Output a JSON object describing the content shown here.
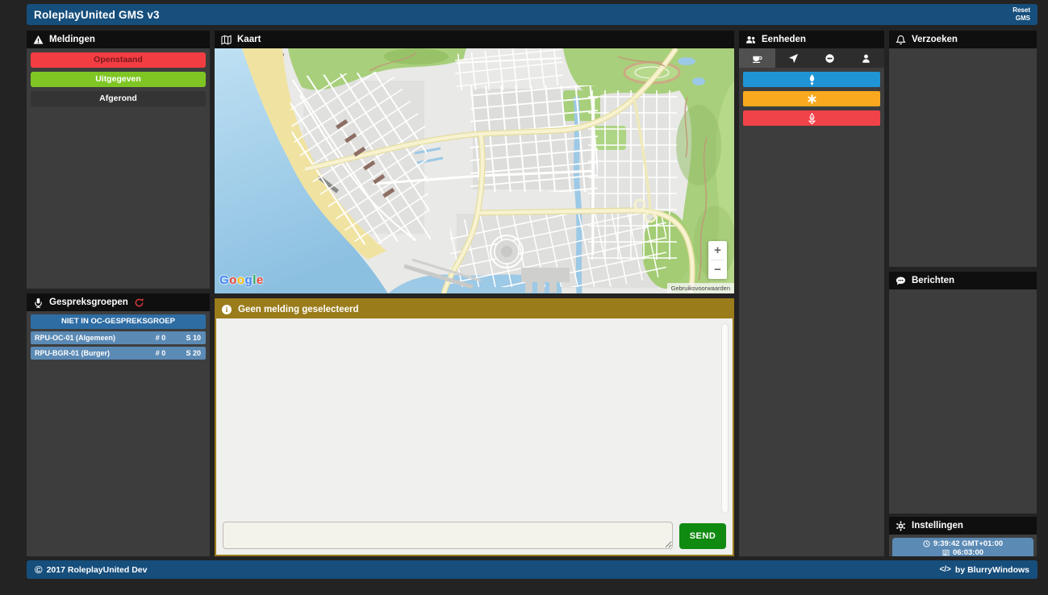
{
  "header": {
    "title": "RoleplayUnited GMS v3",
    "reset_label": "Reset GMS"
  },
  "colors": {
    "topbar_blue": "#164e7c",
    "panel_header": "#0f0f0f",
    "panel_body": "#3d3d3d",
    "gold": "#9a7c1b",
    "table_header_blue": "#2e6da4",
    "table_row_blue": "#5b8ab5",
    "send_green": "#108a10"
  },
  "meldingen": {
    "title": "Meldingen",
    "buttons": [
      {
        "label": "Openstaand",
        "bg": "#f23d43",
        "fg": "#7a191c"
      },
      {
        "label": "Uitgegeven",
        "bg": "#7fc625",
        "fg": "#ffffff"
      },
      {
        "label": "Afgerond",
        "bg": "#343434",
        "fg": "#ffffff"
      }
    ]
  },
  "gespreksgroepen": {
    "title": "Gespreksgroepen",
    "group_header": "NIET IN OC-GESPREKSGROEP",
    "rows": [
      {
        "name": "RPU-OC-01 (Algemeen)",
        "count": "# 0",
        "slot": "S 10"
      },
      {
        "name": "RPU-BGR-01 (Burger)",
        "count": "# 0",
        "slot": "S 20"
      }
    ]
  },
  "kaart": {
    "title": "Kaart",
    "zoom_in": "+",
    "zoom_out": "−",
    "attribution": "Gebruiksvoorwaarden",
    "google_letters": [
      {
        "ch": "G",
        "color": "#4285F4"
      },
      {
        "ch": "o",
        "color": "#EA4335"
      },
      {
        "ch": "o",
        "color": "#FBBC05"
      },
      {
        "ch": "g",
        "color": "#4285F4"
      },
      {
        "ch": "l",
        "color": "#34A853"
      },
      {
        "ch": "e",
        "color": "#EA4335"
      }
    ]
  },
  "melding_detail": {
    "title": "Geen melding geselecteerd",
    "send_label": "SEND",
    "input_value": ""
  },
  "eenheden": {
    "title": "Eenheden",
    "tabs": [
      {
        "icon": "coffee",
        "selected": true
      },
      {
        "icon": "location-arrow",
        "selected": false
      },
      {
        "icon": "ban",
        "selected": false
      },
      {
        "icon": "user",
        "selected": false
      }
    ],
    "units": [
      {
        "type": "politie",
        "color": "#2095d5"
      },
      {
        "type": "ambulance",
        "color": "#f9a91e"
      },
      {
        "type": "brandweer",
        "color": "#f04249"
      }
    ]
  },
  "verzoeken": {
    "title": "Verzoeken"
  },
  "berichten": {
    "title": "Berichten"
  },
  "instellingen": {
    "title": "Instellingen",
    "time": "9:39:42 GMT+01:00",
    "game_time": "06:03:00"
  },
  "footer": {
    "copyright_symbol": "©",
    "copyright": "2017 RoleplayUnited Dev",
    "code_symbol": "</>",
    "credit": "by BlurryWindows"
  }
}
